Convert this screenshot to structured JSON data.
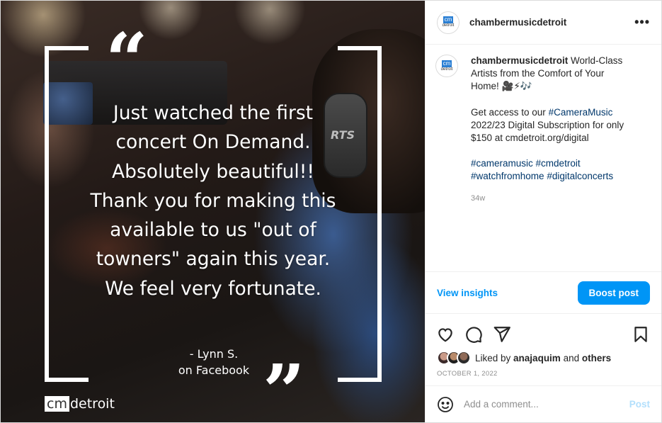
{
  "media": {
    "quote_lines": [
      "Just watched the first",
      "concert On Demand.",
      "Absolutely beautiful!!",
      "Thank you for making this",
      "available to us \"out of",
      "towners\" again this year.",
      "We feel very fortunate."
    ],
    "open_quote": "“",
    "close_quote": "”",
    "author_line1": "- Lynn S.",
    "author_line2": "on Facebook",
    "headset_text": "RTS",
    "logo_cm": "cm",
    "logo_rest": "detroit"
  },
  "header": {
    "avatar_top": "cm",
    "avatar_bottom": "detroit",
    "username": "chambermusicdetroit",
    "more_label": "•••"
  },
  "caption": {
    "username": "chambermusicdetroit",
    "intro": " World-Class Artists from the Comfort of Your Home! 🎥⚡🎶",
    "para2_pre": "Get access to our ",
    "para2_tag": "#CameraMusic",
    "para2_post": " 2022/23 Digital Subscription for only $150 at cmdetroit.org/digital",
    "hashtags": [
      "#cameramusic",
      "#cmdetroit",
      "#watchfromhome",
      "#digitalconcerts"
    ],
    "age": "34w"
  },
  "insights": {
    "view_label": "View insights",
    "boost_label": "Boost post"
  },
  "likes": {
    "prefix": "Liked by ",
    "user": "anajaquim",
    "middle": " and ",
    "others": "others"
  },
  "date": "OCTOBER 1, 2022",
  "comment": {
    "placeholder": "Add a comment...",
    "post_label": "Post"
  },
  "colors": {
    "accent": "#0095f6",
    "link": "#00376b",
    "muted": "#8e8e8e"
  }
}
